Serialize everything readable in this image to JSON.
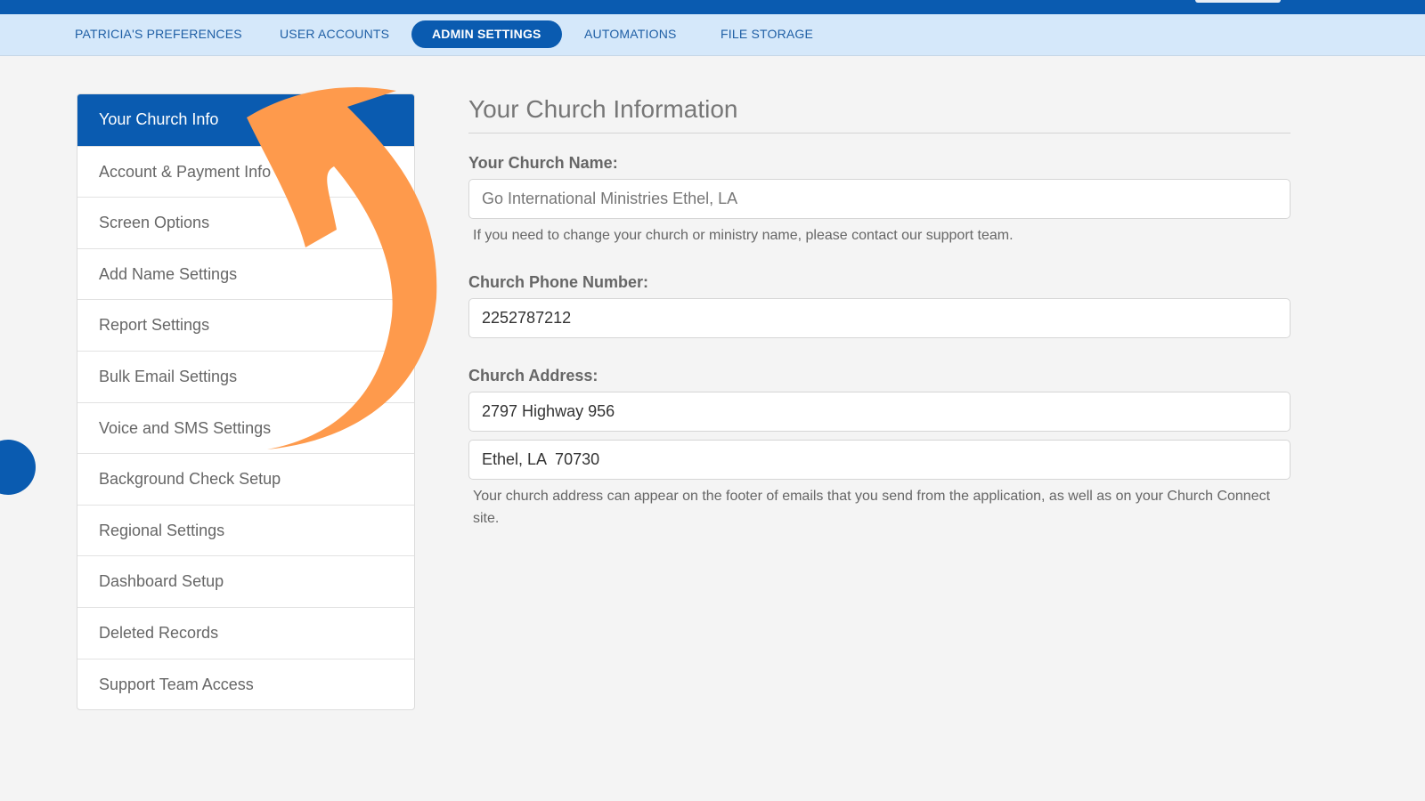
{
  "nav": {
    "tabs": [
      {
        "label": "PATRICIA'S PREFERENCES",
        "active": false
      },
      {
        "label": "USER ACCOUNTS",
        "active": false
      },
      {
        "label": "ADMIN SETTINGS",
        "active": true
      },
      {
        "label": "AUTOMATIONS",
        "active": false
      },
      {
        "label": "FILE STORAGE",
        "active": false
      }
    ]
  },
  "sidebar": {
    "items": [
      {
        "label": "Your Church Info",
        "active": true
      },
      {
        "label": "Account & Payment Info",
        "active": false
      },
      {
        "label": "Screen Options",
        "active": false
      },
      {
        "label": "Add Name Settings",
        "active": false
      },
      {
        "label": "Report Settings",
        "active": false
      },
      {
        "label": "Bulk Email Settings",
        "active": false
      },
      {
        "label": "Voice and SMS Settings",
        "active": false
      },
      {
        "label": "Background Check Setup",
        "active": false
      },
      {
        "label": "Regional Settings",
        "active": false
      },
      {
        "label": "Dashboard Setup",
        "active": false
      },
      {
        "label": "Deleted Records",
        "active": false
      },
      {
        "label": "Support Team Access",
        "active": false
      }
    ]
  },
  "main": {
    "title": "Your Church Information",
    "church_name": {
      "label": "Your Church Name:",
      "value": "Go International Ministries Ethel, LA",
      "help": "If you need to change your church or ministry name, please contact our support team."
    },
    "phone": {
      "label": "Church Phone Number:",
      "value": "2252787212"
    },
    "address": {
      "label": "Church Address:",
      "line1": "2797 Highway 956",
      "line2": "Ethel, LA  70730",
      "help": "Your church address can appear on the footer of emails that you send from the application, as well as on your Church Connect site."
    }
  },
  "colors": {
    "brand_blue": "#0a5bb0",
    "nav_bg": "#d5e8fa",
    "arrow_orange": "#fe9a4c"
  },
  "icons": {
    "annotation": "curved-arrow-icon"
  }
}
